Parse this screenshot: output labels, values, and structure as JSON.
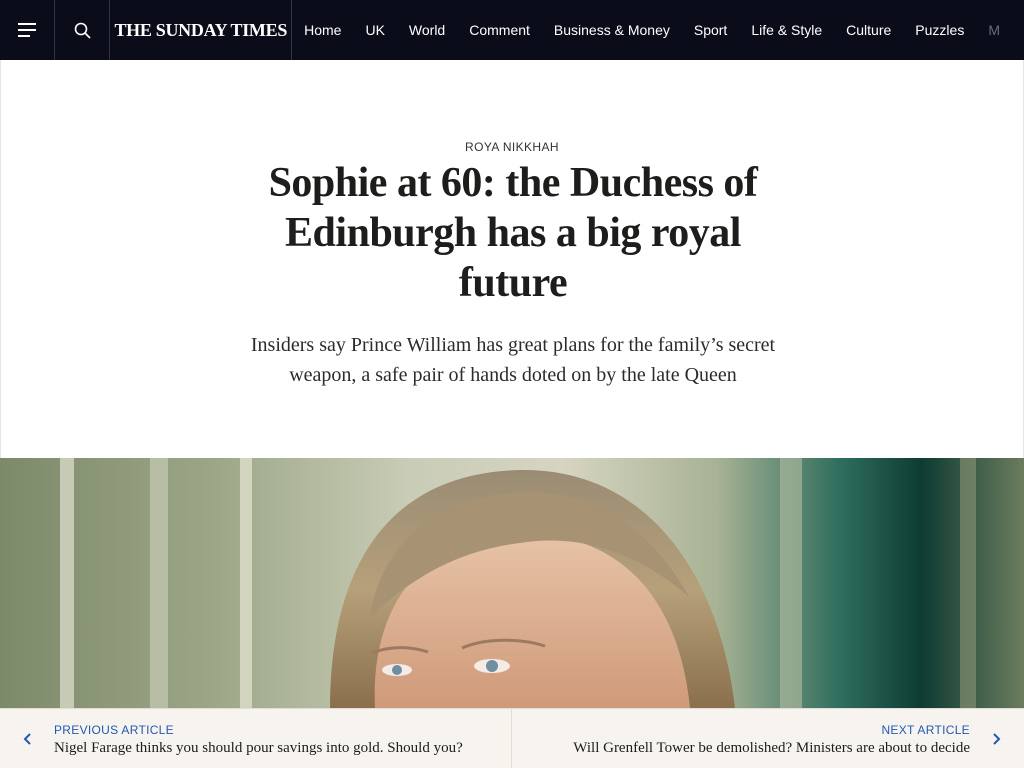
{
  "header": {
    "menu_icon": "hamburger-menu-icon",
    "search_icon": "search-icon",
    "logo_text": "THE SUNDAY TIMES",
    "nav": [
      "Home",
      "UK",
      "World",
      "Comment",
      "Business & Money",
      "Sport",
      "Life & Style",
      "Culture",
      "Puzzles"
    ],
    "nav_partial": "M",
    "background": "#0b0c1a"
  },
  "article": {
    "author": "ROYA NIKKHAH",
    "headline": "Sophie at 60: the Duchess of Edinburgh has a big royal future",
    "standfirst": "Insiders say Prince William has great plans for the family’s secret weapon, a safe pair of hands doted on by the late Queen"
  },
  "article_nav": {
    "previous_label": "PREVIOUS ARTICLE",
    "previous_title": "Nigel Farage thinks you should pour savings into gold. Should you?",
    "next_label": "NEXT ARTICLE",
    "next_title": "Will Grenfell Tower be demolished? Ministers are about to decide",
    "accent_color": "#2359b3"
  }
}
